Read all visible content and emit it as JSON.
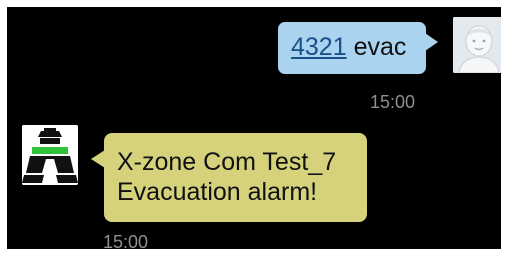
{
  "outgoing": {
    "number": "4321",
    "text": "evac",
    "time": "15:00",
    "avatar_icon": "default-contact-face-icon",
    "bubble_color": "#a9d3ee"
  },
  "incoming": {
    "line1": "X-zone Com Test_7",
    "line2": "Evacuation alarm!",
    "time": "15:00",
    "sender_icon": "x-zone-app-icon",
    "bubble_color": "#d5d27b"
  }
}
